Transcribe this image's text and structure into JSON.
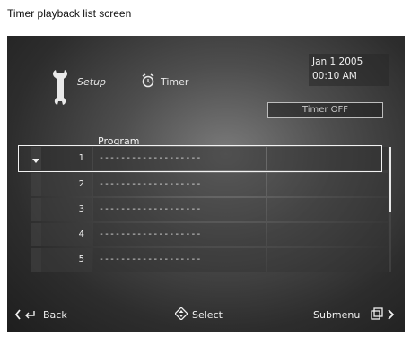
{
  "caption": "Timer playback list screen",
  "header": {
    "setup_label": "Setup",
    "timer_label": "Timer",
    "date": "Jan 1 2005",
    "time": "00:10 AM",
    "timer_status": "Timer OFF"
  },
  "list": {
    "column_header": "Program",
    "rows": [
      {
        "number": "1",
        "program": "-------------------"
      },
      {
        "number": "2",
        "program": "-------------------"
      },
      {
        "number": "3",
        "program": "-------------------"
      },
      {
        "number": "4",
        "program": "-------------------"
      },
      {
        "number": "5",
        "program": "-------------------"
      }
    ],
    "selected_index": 1
  },
  "footer": {
    "back_label": "Back",
    "select_label": "Select",
    "submenu_label": "Submenu"
  },
  "icons": {
    "setup": "wrench-icon",
    "timer": "alarm-clock-icon",
    "back": "return-arrow-icon",
    "select": "dpad-icon",
    "submenu": "submenu-icon"
  }
}
